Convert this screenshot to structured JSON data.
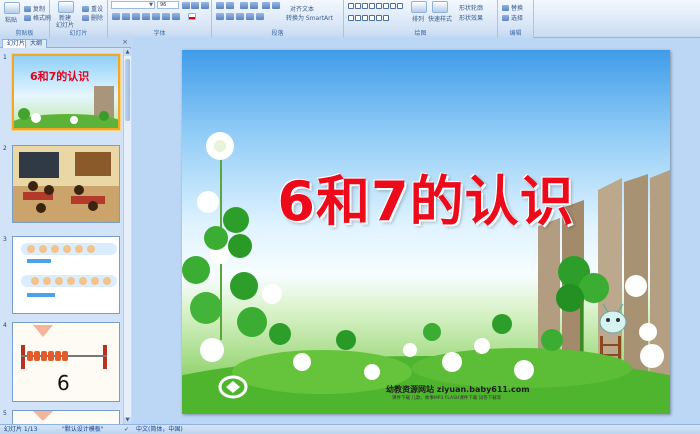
{
  "ribbon": {
    "groups": [
      {
        "id": "clipboard",
        "label": "剪贴板"
      },
      {
        "id": "slides",
        "label": "幻灯片"
      },
      {
        "id": "font",
        "label": "字体"
      },
      {
        "id": "paragraph",
        "label": "段落"
      },
      {
        "id": "drawing",
        "label": "绘图"
      },
      {
        "id": "editing",
        "label": "编辑"
      }
    ],
    "clipboard": {
      "paste": "粘贴",
      "copy": "复制",
      "format_painter": "格式刷"
    },
    "slides": {
      "new_slide": "新建",
      "new_slide_2": "幻灯片",
      "reset": "重设",
      "delete": "删除"
    },
    "font": {
      "size_value": "96"
    },
    "paragraph": {
      "align_text": "对齐文本",
      "convert_smartart": "转换为 SmartArt"
    },
    "drawing": {
      "arrange": "排列",
      "quick_styles": "快速样式",
      "shape_outline": "形状轮廓",
      "shape_effects": "形状效果"
    },
    "editing": {
      "replace": "替换",
      "select": "选择"
    }
  },
  "panel": {
    "tab_slides": "幻灯片",
    "tab_outline": "大纲",
    "close": "×",
    "thumbnails": [
      {
        "num": "1",
        "title": "6和7的认识"
      },
      {
        "num": "2"
      },
      {
        "num": "3"
      },
      {
        "num": "4",
        "big_number": "6"
      },
      {
        "num": "5"
      }
    ]
  },
  "slide": {
    "title": "6和7的认识",
    "site_name": "幼教资源网站  ziyuan.baby611.com",
    "site_sub": "课件下载    儿歌、故事MP3    FLASH课件下载    试卷下载等"
  },
  "status": {
    "slide_pos": "幻灯片 1/13",
    "theme": "\"默认设计模板\"",
    "lang": "中文(简体，中国)"
  },
  "colors": {
    "title_red": "#ed0a1a",
    "ribbon_blue": "#15428b",
    "selection": "#f5a623"
  }
}
